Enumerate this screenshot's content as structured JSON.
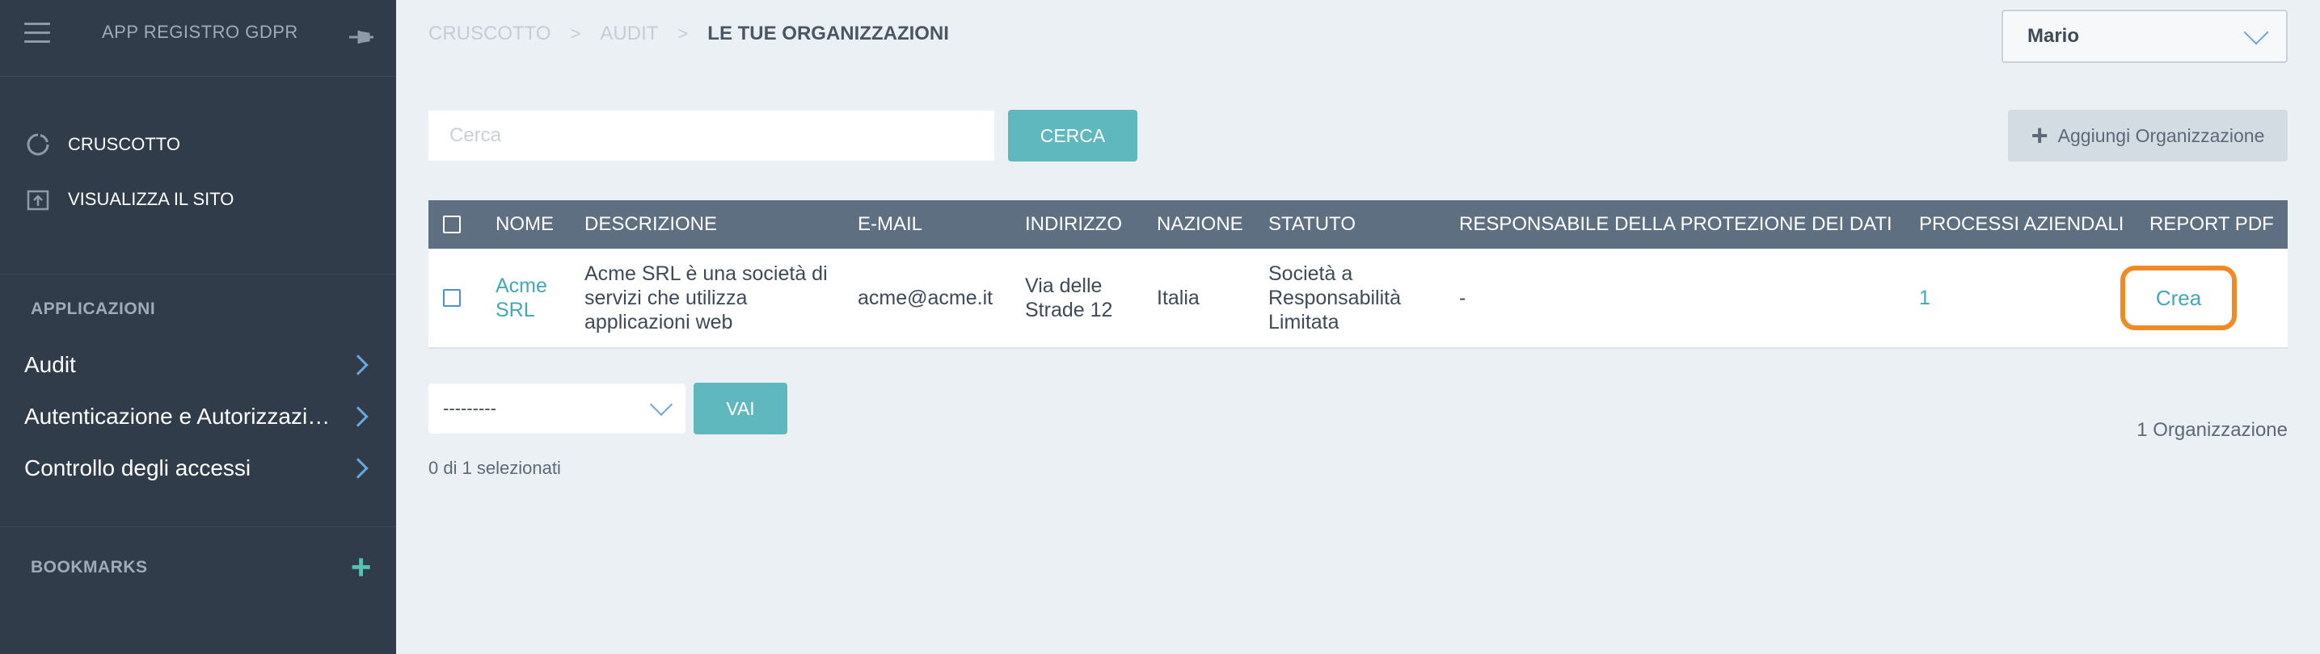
{
  "sidebar": {
    "app_title": "APP REGISTRO GDPR",
    "hamburger_icon": "menu-icon",
    "pin_icon": "pin-icon",
    "links": [
      {
        "label": "CRUSCOTTO",
        "icon": "dashboard-icon"
      },
      {
        "label": "VISUALIZZA IL SITO",
        "icon": "external-site-icon"
      }
    ],
    "applications_title": "APPLICAZIONI",
    "apps": [
      {
        "label": "Audit"
      },
      {
        "label": "Autenticazione e Autorizzazi…"
      },
      {
        "label": "Controllo degli accessi"
      }
    ],
    "bookmarks_title": "BOOKMARKS",
    "bookmarks_add": "+"
  },
  "header": {
    "breadcrumb": [
      "CRUSCOTTO",
      "AUDIT",
      "LE TUE ORGANIZZAZIONI"
    ],
    "separator": ">",
    "user": "Mario"
  },
  "toolbar": {
    "search_placeholder": "Cerca",
    "search_button": "CERCA",
    "add_button": "Aggiungi Organizzazione"
  },
  "table": {
    "columns": [
      "NOME",
      "DESCRIZIONE",
      "E-MAIL",
      "INDIRIZZO",
      "NAZIONE",
      "STATUTO",
      "RESPONSABILE DELLA PROTEZIONE DEI DATI",
      "PROCESSI AZIENDALI",
      "REPORT PDF"
    ],
    "rows": [
      {
        "nome": "Acme SRL",
        "descrizione": "Acme SRL è una società di servizi che utilizza applicazioni web",
        "email": "acme@acme.it",
        "indirizzo": "Via delle Strade 12",
        "nazione": "Italia",
        "statuto": "Società a Responsabilità Limitata",
        "responsabile": "-",
        "processi": "1",
        "report": "Crea"
      }
    ]
  },
  "actions": {
    "select_value": "---------",
    "go_button": "VAI",
    "selected_text": "0 di 1 selezionati",
    "count_text": "1 Organizzazione"
  },
  "colors": {
    "sidebar_bg": "#303c4a",
    "accent_teal": "#5fb8bd",
    "table_header_bg": "#5e6f82",
    "highlight_orange": "#f08a24"
  }
}
